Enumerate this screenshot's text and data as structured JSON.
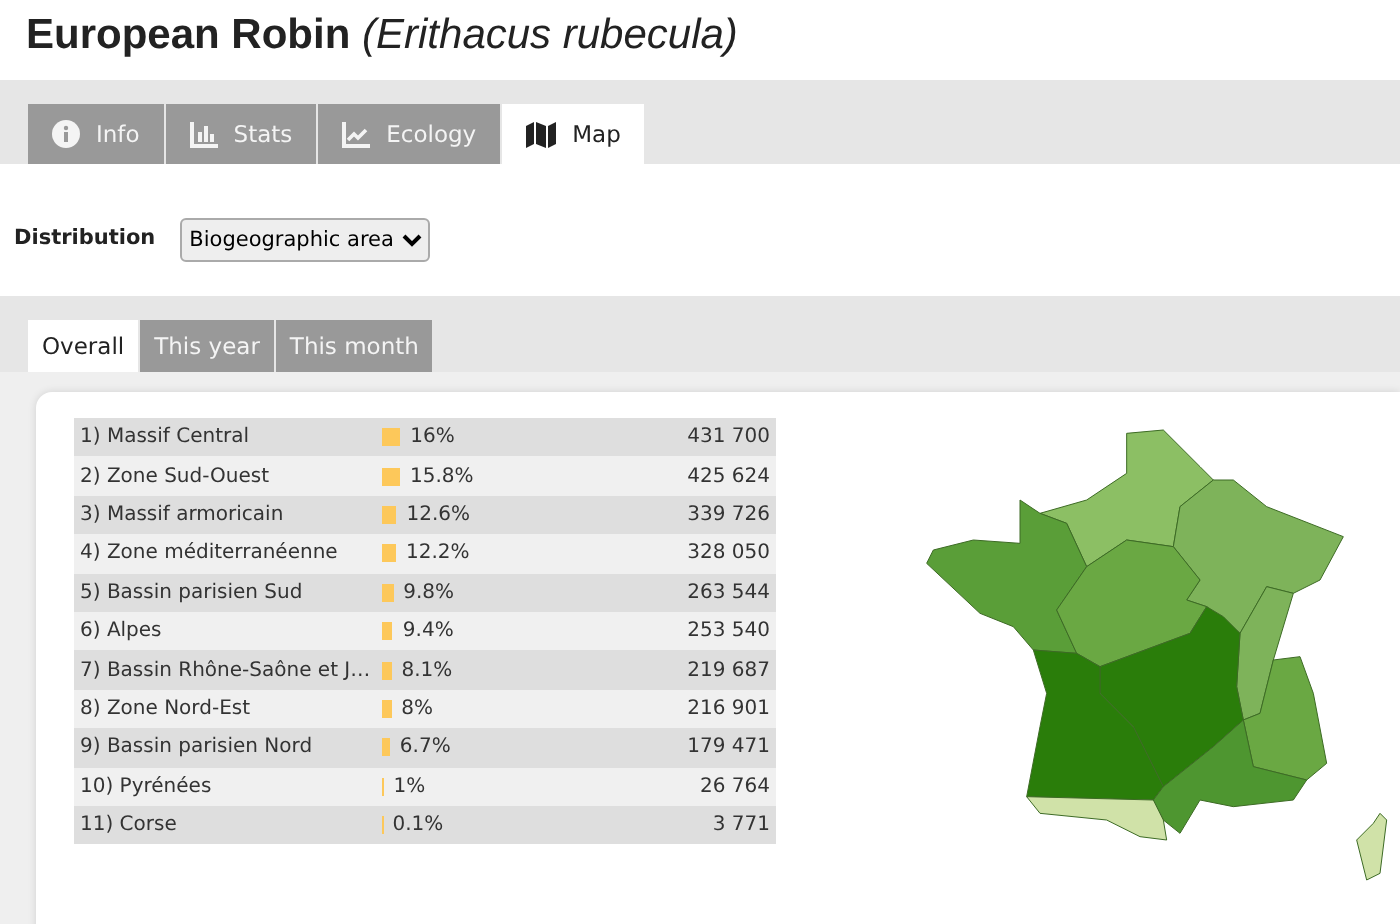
{
  "title": {
    "name": "European Robin",
    "scientific": "(Erithacus rubecula)"
  },
  "tabs": [
    {
      "label": "Info",
      "kind": "info",
      "selected": false
    },
    {
      "label": "Stats",
      "kind": "bars",
      "selected": false
    },
    {
      "label": "Ecology",
      "kind": "line",
      "selected": false
    },
    {
      "label": "Map",
      "kind": "map",
      "selected": true
    }
  ],
  "distribution": {
    "label": "Distribution",
    "value": "Biogeographic area"
  },
  "period_tabs": [
    {
      "label": "Overall",
      "selected": true
    },
    {
      "label": "This year",
      "selected": false
    },
    {
      "label": "This month",
      "selected": false
    }
  ],
  "table": {
    "rows": [
      {
        "area": "1) Massif Central",
        "share": "16%",
        "count": "431 700"
      },
      {
        "area": "2) Zone Sud-Ouest",
        "share": "15.8%",
        "count": "425 624"
      },
      {
        "area": "3) Massif armoricain",
        "share": "12.6%",
        "count": "339 726"
      },
      {
        "area": "4) Zone méditerranéenne",
        "share": "12.2%",
        "count": "328 050"
      },
      {
        "area": "5) Bassin parisien Sud",
        "share": "9.8%",
        "count": "263 544"
      },
      {
        "area": "6) Alpes",
        "share": "9.4%",
        "count": "253 540"
      },
      {
        "area": "7) Bassin Rhône-Saône et J…",
        "share": "8.1%",
        "count": "219 687"
      },
      {
        "area": "8) Zone Nord-Est",
        "share": "8%",
        "count": "216 901"
      },
      {
        "area": "9) Bassin parisien Nord",
        "share": "6.7%",
        "count": "179 471"
      },
      {
        "area": "10) Pyrénées",
        "share": "1%",
        "count": "26 764"
      },
      {
        "area": "11) Corse",
        "share": "0.1%",
        "count": "3 771"
      }
    ]
  }
}
